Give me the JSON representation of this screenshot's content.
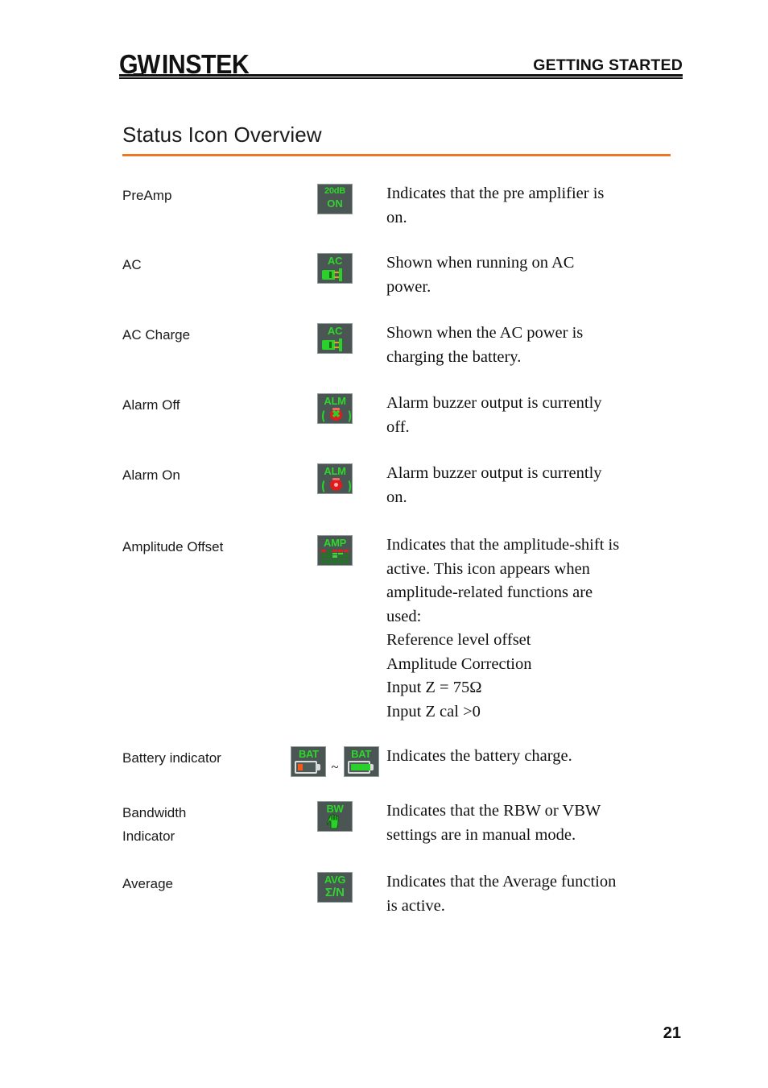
{
  "header": {
    "logo_gw": "GW",
    "logo_instek": "INSTEK",
    "title": "GETTING STARTED"
  },
  "section": {
    "title": "Status Icon Overview",
    "accent_color": "#ef7622"
  },
  "icon_colors": {
    "icon_background": "#4b5654",
    "icon_border": "#8e9a98",
    "green": "#2ad12a",
    "red": "#e01b1b",
    "orange": "#f4581a",
    "prong_yellow": "#e8a022"
  },
  "rows": [
    {
      "label": "PreAmp",
      "icon_name": "preamp-icon",
      "icon_caption": "20dB",
      "icon_subcaption": "ON",
      "description": [
        "Indicates that the pre amplifier is",
        "on."
      ]
    },
    {
      "label": "AC",
      "icon_name": "ac-power-icon",
      "icon_caption": "AC",
      "description": [
        "Shown when running on AC",
        "power."
      ]
    },
    {
      "label": "AC Charge",
      "icon_name": "ac-charge-icon",
      "icon_caption": "AC",
      "description": [
        "Shown when the AC power is",
        "charging the battery."
      ]
    },
    {
      "label": "Alarm Off",
      "icon_name": "alarm-off-icon",
      "icon_caption": "ALM",
      "description": [
        "Alarm buzzer output is currently",
        "off."
      ]
    },
    {
      "label": "Alarm On",
      "icon_name": "alarm-on-icon",
      "icon_caption": "ALM",
      "description": [
        "Alarm buzzer output is currently",
        "on."
      ]
    },
    {
      "label": "Amplitude Offset",
      "icon_name": "amplitude-offset-icon",
      "icon_caption": "AMP",
      "description": [
        "Indicates that the amplitude-shift is",
        "active. This icon appears when",
        "amplitude-related functions are",
        "used:",
        "Reference level offset",
        "Amplitude Correction",
        "Input Z = 75Ω",
        "Input Z cal >0"
      ]
    },
    {
      "label": "Battery indicator",
      "icon_name": "battery-indicator-icon",
      "icon_caption": "BAT",
      "icon_caption_2": "BAT",
      "separator": "~",
      "description": [
        "Indicates the battery charge."
      ]
    },
    {
      "label": "Bandwidth Indicator",
      "label_lines": [
        "Bandwidth",
        "Indicator"
      ],
      "icon_name": "bandwidth-indicator-icon",
      "icon_caption": "BW",
      "description": [
        "Indicates that the RBW or VBW",
        "settings are in manual mode."
      ]
    },
    {
      "label": "Average",
      "icon_name": "average-icon",
      "icon_caption": "AVG",
      "icon_subcaption": "Σ/N",
      "description": [
        "Indicates that the Average function",
        "is active."
      ]
    }
  ],
  "footer": {
    "page_number": "21"
  }
}
